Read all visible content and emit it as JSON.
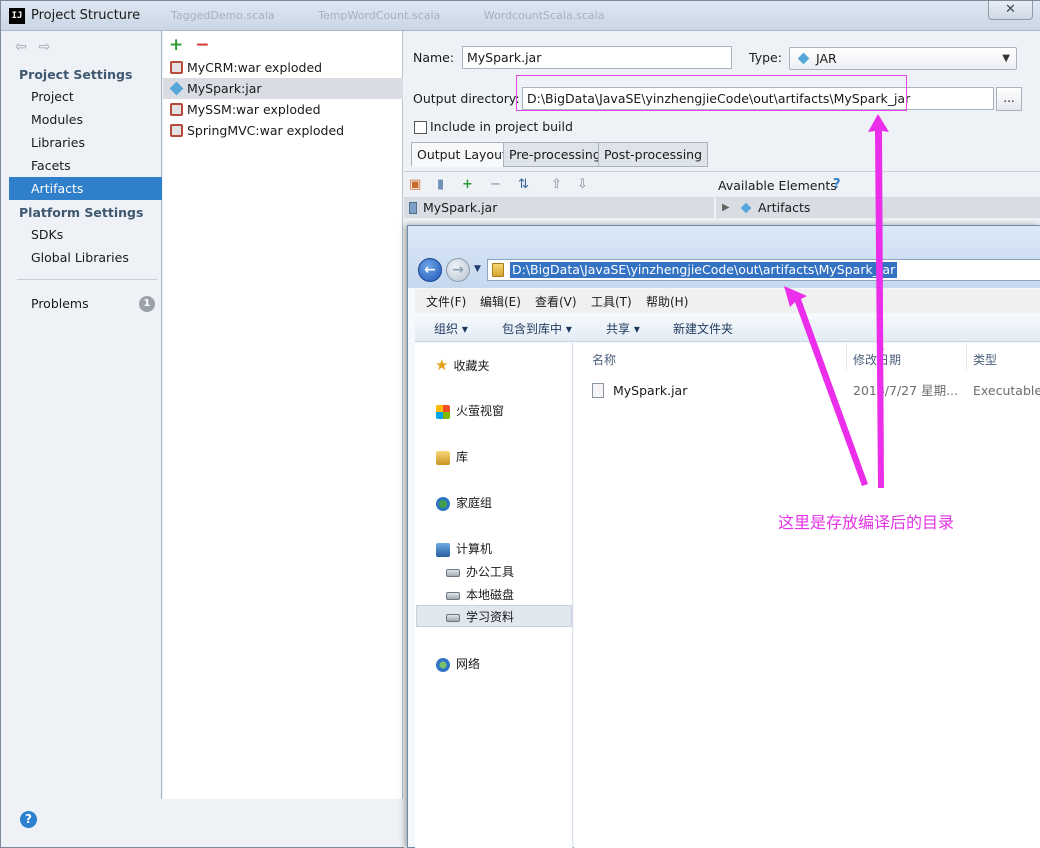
{
  "window": {
    "title": "Project Structure",
    "logo": "IJ",
    "close_glyph": "✕"
  },
  "ghost_tabs": [
    "TaggedDemo.scala",
    "TempWordCount.scala",
    "WordcountScala.scala"
  ],
  "nav": {
    "back_glyph": "⇦",
    "forward_glyph": "⇨",
    "project_settings_heading": "Project Settings",
    "project_items": [
      "Project",
      "Modules",
      "Libraries",
      "Facets",
      "Artifacts"
    ],
    "platform_settings_heading": "Platform Settings",
    "platform_items": [
      "SDKs",
      "Global Libraries"
    ],
    "problems_label": "Problems",
    "problems_count": "1",
    "help_glyph": "?"
  },
  "artifacts": {
    "add_glyph": "+",
    "remove_glyph": "−",
    "items": [
      {
        "label": "MyCRM:war exploded",
        "icon": "war-icon"
      },
      {
        "label": "MySpark:jar",
        "icon": "jar-icon"
      },
      {
        "label": "MySSM:war exploded",
        "icon": "war-icon"
      },
      {
        "label": "SpringMVC:war exploded",
        "icon": "war-icon"
      }
    ],
    "selected": "MySpark:jar"
  },
  "detail": {
    "name_label": "Name:",
    "name_value": "MySpark.jar",
    "type_label": "Type:",
    "type_value": "JAR",
    "output_label": "Output directory:",
    "output_value": "D:\\BigData\\JavaSE\\yinzhengjieCode\\out\\artifacts\\MySpark_jar",
    "browse_label": "...",
    "include_label": "Include in project build",
    "include_checked": false,
    "tabs": [
      "Output Layout",
      "Pre-processing",
      "Post-processing"
    ],
    "active_tab": "Output Layout",
    "available_elements_label": "Available Elements",
    "help_glyph": "?",
    "layout_root": "MySpark.jar",
    "available_root": "Artifacts"
  },
  "explorer": {
    "path": "D:\\BigData\\JavaSE\\yinzhengjieCode\\out\\artifacts\\MySpark_jar",
    "menu": [
      "文件(F)",
      "编辑(E)",
      "查看(V)",
      "工具(T)",
      "帮助(H)"
    ],
    "commands": [
      "组织 ▾",
      "包含到库中 ▾",
      "共享 ▾",
      "新建文件夹"
    ],
    "nav": {
      "favorites": "收藏夹",
      "videos": "火萤视窗",
      "library": "库",
      "homegroup": "家庭组",
      "computer": "计算机",
      "drives": [
        "办公工具",
        "本地磁盘",
        "学习资料"
      ],
      "selected_drive": "学习资料",
      "network": "网络"
    },
    "columns": [
      "名称",
      "修改日期",
      "类型"
    ],
    "files": [
      {
        "name": "MySpark.jar",
        "modified": "2018/7/27 星期...",
        "type": "Executable ..."
      }
    ]
  },
  "annotation": {
    "text": "这里是存放编译后的目录",
    "color": "#e334e6"
  },
  "colors": {
    "selection_blue": "#2f7fcb",
    "explorer_path_highlight": "#3472c4",
    "annotation_magenta": "#e334e6"
  }
}
